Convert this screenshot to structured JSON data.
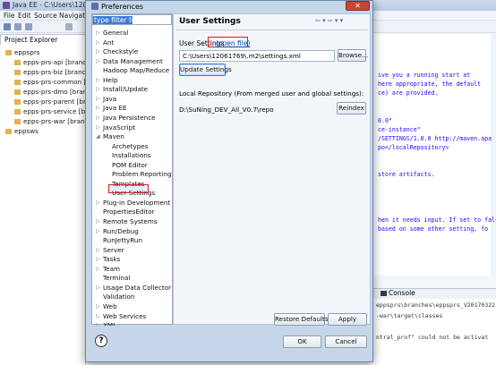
{
  "eclipse": {
    "title": "Java EE - C:\\Users\\12061769\\",
    "menu": [
      "File",
      "Edit",
      "Source",
      "Navigate"
    ],
    "explorer_tab": "Project Explorer",
    "projects": [
      "eppsprs",
      "epps-prs-api [branch",
      "epps-prs-biz [branch",
      "epps-prs-common [",
      "epps-prs-dmo [branc",
      "epps-prs-parent [bra",
      "epps-prs-service [bra",
      "epps-prs-war [branc",
      "eppsws"
    ],
    "editor_lines": [
      "ive you a running start at",
      "here appropriate, the default",
      "ce) are provided.",
      "",
      "",
      "0.0\"",
      "ce-instance\"",
      "/SETTINGS/1.0.0 http://maven.apa",
      "po</localRepository>",
      "",
      "",
      "store artifacts.",
      "",
      "",
      "",
      "",
      "hen it needs input. If set to fals",
      " based on some other setting, fo"
    ],
    "console_tab": "Console",
    "console_lines": [
      "eppsprs\\branches\\eppsprs_V20170322",
      "-war\\target\\classes",
      "",
      "ntral_prof\" could not be activat"
    ]
  },
  "dialog": {
    "title": "Preferences",
    "close_label": "✕",
    "filter_placeholder": "type filter text",
    "tree": [
      {
        "label": "General",
        "level": 0,
        "twisty": "▷"
      },
      {
        "label": "Ant",
        "level": 0,
        "twisty": "▷"
      },
      {
        "label": "Checkstyle",
        "level": 0,
        "twisty": "▷"
      },
      {
        "label": "Data Management",
        "level": 0,
        "twisty": "▷"
      },
      {
        "label": "Hadoop Map/Reduce",
        "level": 0,
        "twisty": ""
      },
      {
        "label": "Help",
        "level": 0,
        "twisty": "▷"
      },
      {
        "label": "Install/Update",
        "level": 0,
        "twisty": "▷"
      },
      {
        "label": "Java",
        "level": 0,
        "twisty": "▷"
      },
      {
        "label": "Java EE",
        "level": 0,
        "twisty": "▷"
      },
      {
        "label": "Java Persistence",
        "level": 0,
        "twisty": "▷"
      },
      {
        "label": "JavaScript",
        "level": 0,
        "twisty": "▷"
      },
      {
        "label": "Maven",
        "level": 0,
        "twisty": "◢"
      },
      {
        "label": "Archetypes",
        "level": 1,
        "twisty": ""
      },
      {
        "label": "Installations",
        "level": 1,
        "twisty": ""
      },
      {
        "label": "POM Editor",
        "level": 1,
        "twisty": ""
      },
      {
        "label": "Problem Reporting",
        "level": 1,
        "twisty": ""
      },
      {
        "label": "Templates",
        "level": 1,
        "twisty": ""
      },
      {
        "label": "User Settings",
        "level": 1,
        "twisty": ""
      },
      {
        "label": "Plug-in Development",
        "level": 0,
        "twisty": "▷"
      },
      {
        "label": "PropertiesEditor",
        "level": 0,
        "twisty": ""
      },
      {
        "label": "Remote Systems",
        "level": 0,
        "twisty": "▷"
      },
      {
        "label": "Run/Debug",
        "level": 0,
        "twisty": "▷"
      },
      {
        "label": "RunJettyRun",
        "level": 0,
        "twisty": ""
      },
      {
        "label": "Server",
        "level": 0,
        "twisty": "▷"
      },
      {
        "label": "Tasks",
        "level": 0,
        "twisty": "▷"
      },
      {
        "label": "Team",
        "level": 0,
        "twisty": "▷"
      },
      {
        "label": "Terminal",
        "level": 0,
        "twisty": ""
      },
      {
        "label": "Usage Data Collector",
        "level": 0,
        "twisty": "▷"
      },
      {
        "label": "Validation",
        "level": 0,
        "twisty": ""
      },
      {
        "label": "Web",
        "level": 0,
        "twisty": "▷"
      },
      {
        "label": "Web Services",
        "level": 0,
        "twisty": "▷"
      },
      {
        "label": "XML",
        "level": 0,
        "twisty": "▷"
      }
    ],
    "selected_item": "User Settings",
    "page": {
      "title": "User Settings",
      "nav_icons": "⇦ ▾ ⇨ ▾ ▾",
      "user_settings_label": "User Settings",
      "open_file_link": "(open file)",
      "settings_path": "C:\\Users\\12061769\\.m2\\settings.xml",
      "browse_button": "Browse...",
      "update_button": "Update Settings",
      "local_repo_label": "Local Repository (From merged user and global settings):",
      "local_repo_value": "D:\\SuNing_DEV_All_V0.7\\repo",
      "reindex_button": "Reindex",
      "restore_defaults_button": "Restore Defaults",
      "apply_button": "Apply"
    },
    "help_label": "?",
    "ok_button": "OK",
    "cancel_button": "Cancel"
  }
}
